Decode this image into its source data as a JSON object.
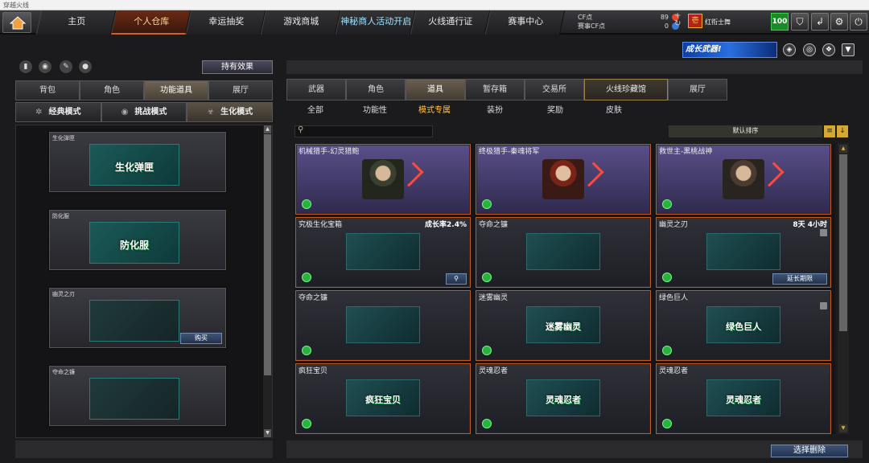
{
  "window": {
    "title": "穿越火线"
  },
  "nav": {
    "tabs": [
      "主页",
      "个人仓库",
      "幸运抽奖",
      "游戏商城",
      "神秘商人活动开启",
      "火线通行证",
      "赛事中心"
    ]
  },
  "currency": {
    "cf_label": "CF点",
    "cf_value": "89",
    "event_label": "赛事CF点",
    "event_value": "0"
  },
  "player": {
    "rank_name": "红衔士舞",
    "rank_glyph": "壱",
    "level": "100"
  },
  "banner": {
    "text": "成长武器!"
  },
  "left": {
    "hold_effect_label": "持有效果",
    "tabs1": [
      "背包",
      "角色",
      "功能道具",
      "展厅"
    ],
    "tabs2": [
      "经典模式",
      "挑战模式",
      "生化模式"
    ],
    "items": [
      {
        "name": "生化弹匣",
        "img_label": "生化弹匣"
      },
      {
        "name": "防化服",
        "img_label": "防化服"
      },
      {
        "name": "幽灵之刃",
        "buy": "购买"
      },
      {
        "name": "夺命之镰"
      }
    ]
  },
  "right": {
    "tabs1": [
      "武器",
      "角色",
      "道具",
      "暂存箱",
      "交易所",
      "火线珍藏馆",
      "展厅"
    ],
    "tabs2": [
      "全部",
      "功能性",
      "模式专属",
      "装扮",
      "奖励",
      "皮肤"
    ],
    "sort_label": "默认排序",
    "cards": [
      {
        "name": "机械猎手-幻灵猎鲍"
      },
      {
        "name": "终极猎手-秦魂将军"
      },
      {
        "name": "救世主-黑桃战神"
      },
      {
        "name": "究极生化宝箱",
        "right": "成长率2.4%"
      },
      {
        "name": "夺命之镰"
      },
      {
        "name": "幽灵之刃",
        "right": "8天 4小时",
        "extend": "延长期限"
      },
      {
        "name": "夺命之镰"
      },
      {
        "name": "迷雾幽灵",
        "img_label": "迷雾幽灵"
      },
      {
        "name": "绿色巨人",
        "img_label": "绿色巨人"
      },
      {
        "name": "疯狂宝贝",
        "img_label": "疯狂宝贝"
      },
      {
        "name": "灵魂忍者",
        "img_label": "灵魂忍者"
      },
      {
        "name": "灵魂忍者",
        "img_label": "灵魂忍者"
      }
    ],
    "delete_label": "选择删除"
  }
}
